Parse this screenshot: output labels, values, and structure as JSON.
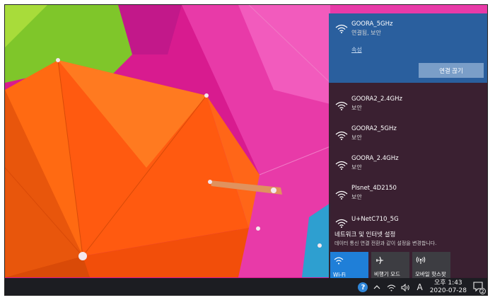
{
  "taskbar": {
    "time": "오후 1:43",
    "date": "2020-07-28",
    "ime_label": "A",
    "notification_count": "2",
    "help_label": "?"
  },
  "network_flyout": {
    "connected": {
      "ssid": "GOORA_5GHz",
      "status": "연결됨, 보안",
      "properties_link": "속성",
      "disconnect_button": "연결 끊기"
    },
    "networks": [
      {
        "ssid": "GOORA2_2.4GHz",
        "status": "보안"
      },
      {
        "ssid": "GOORA2_5GHz",
        "status": "보안"
      },
      {
        "ssid": "GOORA_2.4GHz",
        "status": "보안"
      },
      {
        "ssid": "PIsnet_4D2150",
        "status": "보안"
      },
      {
        "ssid": "U+NetC710_5G",
        "status": ""
      }
    ],
    "settings_title": "네트워크 및 인터넷 설정",
    "settings_desc": "데이터 통신 연결 전환과 같이 설정을 변경합니다."
  },
  "quick_actions": [
    {
      "label": "Wi-Fi",
      "icon": "wifi-icon",
      "active": true
    },
    {
      "label": "비행기 모드",
      "icon": "airplane-icon",
      "active": false
    },
    {
      "label": "모바일 핫스팟",
      "icon": "hotspot-icon",
      "active": false
    }
  ],
  "colors": {
    "accent": "#1f7fd8",
    "connected_bg": "#2a5f9e",
    "flyout_bg": "#2c1e28",
    "taskbar_bg": "#1c1d22"
  }
}
